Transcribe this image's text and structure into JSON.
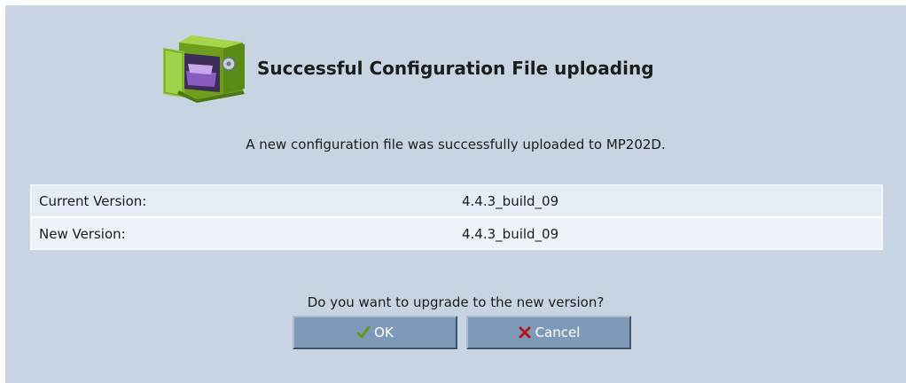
{
  "dialog": {
    "title": "Successful Configuration File uploading",
    "message": "A new configuration file was successfully uploaded to MP202D.",
    "question": "Do you want to upgrade to the new version?",
    "header_icon": "safe-box-icon"
  },
  "versions": [
    {
      "label": "Current Version:",
      "value": "4.4.3_build_09"
    },
    {
      "label": "New Version:",
      "value": "4.4.3_build_09"
    }
  ],
  "buttons": {
    "ok_label": "OK",
    "ok_icon": "check-icon",
    "cancel_label": "Cancel",
    "cancel_icon": "x-icon"
  },
  "colors": {
    "panel_bg": "#c8d4e2",
    "button_bg": "#7f9ab8",
    "check": "#5e9a1b",
    "cross": "#b3161a"
  }
}
